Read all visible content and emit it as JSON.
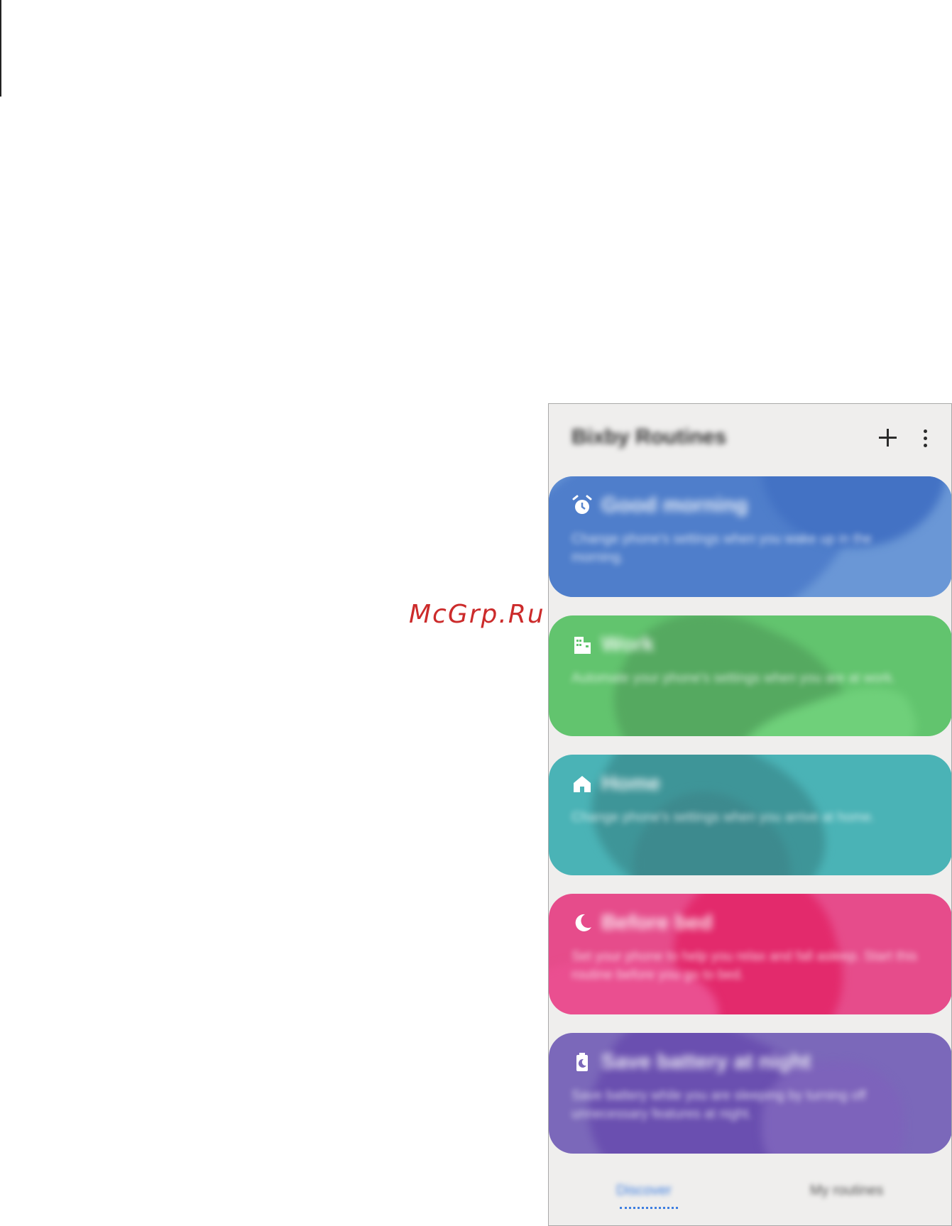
{
  "watermark": "McGrp.Ru",
  "app": {
    "title": "Bixby Routines",
    "add_icon": "plus-icon",
    "more_icon": "more-vert-icon"
  },
  "cards": [
    {
      "title": "Good morning",
      "description": "Change phone's settings when you wake up in the morning.",
      "icon": "alarm-icon",
      "color": "#6a97d6"
    },
    {
      "title": "Work",
      "description": "Automate your phone's settings when you are at work.",
      "icon": "building-icon",
      "color": "#62c46e"
    },
    {
      "title": "Home",
      "description": "Change phone's settings when you arrive at home.",
      "icon": "home-icon",
      "color": "#4ab3b6"
    },
    {
      "title": "Before bed",
      "description": "Set your phone to help you relax and fall asleep. Start this routine before you go to bed.",
      "icon": "moon-icon",
      "color": "#e64c8b"
    },
    {
      "title": "Save battery at night",
      "description": "Save battery while you are sleeping by turning off unnecessary features at night.",
      "icon": "battery-moon-icon",
      "color": "#7b68ba"
    }
  ],
  "tabs": [
    {
      "label": "Discover",
      "active": true
    },
    {
      "label": "My routines",
      "active": false
    }
  ]
}
